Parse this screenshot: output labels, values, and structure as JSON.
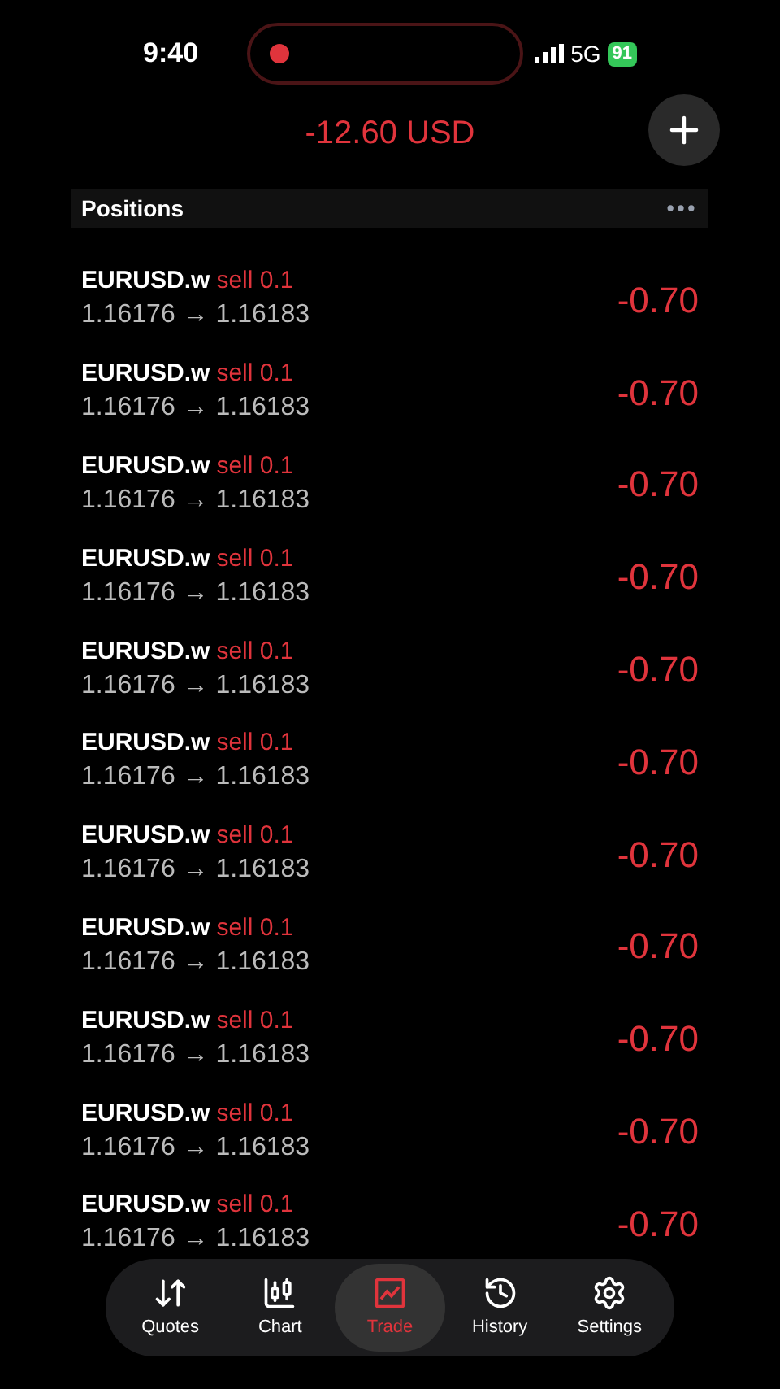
{
  "status_bar": {
    "time": "9:40",
    "network": "5G",
    "battery": "91"
  },
  "header": {
    "balance": "-12.60 USD"
  },
  "positions": {
    "title": "Positions",
    "rows": [
      {
        "symbol": "EURUSD.w",
        "side": "sell 0.1",
        "prices": "1.16176 → 1.16183",
        "profit": "-0.70"
      },
      {
        "symbol": "EURUSD.w",
        "side": "sell 0.1",
        "prices": "1.16176 → 1.16183",
        "profit": "-0.70"
      },
      {
        "symbol": "EURUSD.w",
        "side": "sell 0.1",
        "prices": "1.16176 → 1.16183",
        "profit": "-0.70"
      },
      {
        "symbol": "EURUSD.w",
        "side": "sell 0.1",
        "prices": "1.16176 → 1.16183",
        "profit": "-0.70"
      },
      {
        "symbol": "EURUSD.w",
        "side": "sell 0.1",
        "prices": "1.16176 → 1.16183",
        "profit": "-0.70"
      },
      {
        "symbol": "EURUSD.w",
        "side": "sell 0.1",
        "prices": "1.16176 → 1.16183",
        "profit": "-0.70"
      },
      {
        "symbol": "EURUSD.w",
        "side": "sell 0.1",
        "prices": "1.16176 → 1.16183",
        "profit": "-0.70"
      },
      {
        "symbol": "EURUSD.w",
        "side": "sell 0.1",
        "prices": "1.16176 → 1.16183",
        "profit": "-0.70"
      },
      {
        "symbol": "EURUSD.w",
        "side": "sell 0.1",
        "prices": "1.16176 → 1.16183",
        "profit": "-0.70"
      },
      {
        "symbol": "EURUSD.w",
        "side": "sell 0.1",
        "prices": "1.16176 → 1.16183",
        "profit": "-0.70"
      },
      {
        "symbol": "EURUSD.w",
        "side": "sell 0.1",
        "prices": "1.16176 → 1.16183",
        "profit": "-0.70"
      }
    ]
  },
  "tab_bar": [
    {
      "kind": "quotes",
      "label": "Quotes",
      "selected": false
    },
    {
      "kind": "chart",
      "label": "Chart",
      "selected": false
    },
    {
      "kind": "trade",
      "label": "Trade",
      "selected": true
    },
    {
      "kind": "history",
      "label": "History",
      "selected": false
    },
    {
      "kind": "settings",
      "label": "Settings",
      "selected": false
    }
  ]
}
